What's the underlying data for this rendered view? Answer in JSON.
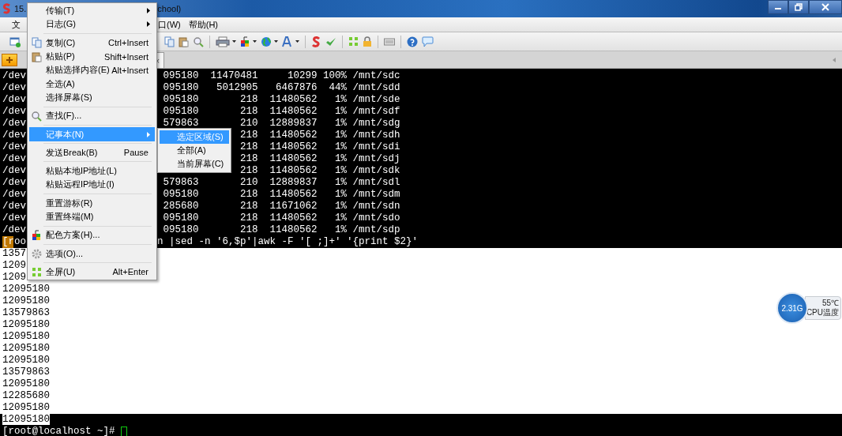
{
  "window": {
    "title_start": "15.",
    "title_end": "chool)"
  },
  "menubar": [
    "文",
    "口(W)",
    "帮助(H)"
  ],
  "tab": {
    "close": "×"
  },
  "context_menu": {
    "items": [
      {
        "kind": "item",
        "label": "传输(T)",
        "submenu": true,
        "selected": false
      },
      {
        "kind": "item",
        "label": "日志(G)",
        "submenu": true,
        "selected": false
      },
      {
        "kind": "separator"
      },
      {
        "kind": "item",
        "label": "复制(C)",
        "shortcut": "Ctrl+Insert",
        "submenu": false,
        "selected": false
      },
      {
        "kind": "item",
        "label": "粘贴(P)",
        "shortcut": "Shift+Insert",
        "submenu": false,
        "selected": false
      },
      {
        "kind": "item",
        "label": "粘贴选择内容(E)",
        "shortcut": "Alt+Insert",
        "submenu": false,
        "selected": false
      },
      {
        "kind": "item",
        "label": "全选(A)",
        "submenu": false,
        "selected": false
      },
      {
        "kind": "item",
        "label": "选择屏幕(S)",
        "submenu": false,
        "selected": false
      },
      {
        "kind": "separator"
      },
      {
        "kind": "item",
        "label": "查找(F)...",
        "submenu": false,
        "selected": false
      },
      {
        "kind": "separator"
      },
      {
        "kind": "item",
        "label": "记事本(N)",
        "submenu": true,
        "selected": true
      },
      {
        "kind": "separator"
      },
      {
        "kind": "item",
        "label": "发送Break(B)",
        "shortcut": "Pause",
        "submenu": false,
        "selected": false
      },
      {
        "kind": "separator"
      },
      {
        "kind": "item",
        "label": "粘贴本地IP地址(L)",
        "submenu": false,
        "selected": false
      },
      {
        "kind": "item",
        "label": "粘贴远程IP地址(I)",
        "submenu": false,
        "selected": false
      },
      {
        "kind": "separator"
      },
      {
        "kind": "item",
        "label": "重置游标(R)",
        "submenu": false,
        "selected": false
      },
      {
        "kind": "item",
        "label": "重置终端(M)",
        "submenu": false,
        "selected": false
      },
      {
        "kind": "separator"
      },
      {
        "kind": "item",
        "label": "配色方案(H)...",
        "submenu": false,
        "selected": false
      },
      {
        "kind": "separator"
      },
      {
        "kind": "item",
        "label": "选项(O)...",
        "submenu": false,
        "selected": false
      },
      {
        "kind": "separator"
      },
      {
        "kind": "item",
        "label": "全屏(U)",
        "shortcut": "Alt+Enter",
        "submenu": false,
        "selected": false
      }
    ]
  },
  "submenu": {
    "items": [
      {
        "label": "选定区域(S)",
        "selected": true
      },
      {
        "label": "全部(A)",
        "selected": false
      },
      {
        "label": "当前屏幕(C)",
        "selected": false
      }
    ]
  },
  "terminal": {
    "disk_rows": [
      {
        "left": "/dev",
        "right": "095180  11470481     10299 100% /mnt/sdc"
      },
      {
        "left": "/dev",
        "right": "095180   5012905   6467876  44% /mnt/sdd"
      },
      {
        "left": "/dev",
        "right": "095180       218  11480562   1% /mnt/sde"
      },
      {
        "left": "/dev",
        "right": "095180       218  11480562   1% /mnt/sdf"
      },
      {
        "left": "/dev",
        "right": "579863       210  12889837   1% /mnt/sdg"
      },
      {
        "left": "/dev",
        "right": "218  11480562   1% /mnt/sdh"
      },
      {
        "left": "/dev",
        "right": "218  11480562   1% /mnt/sdi"
      },
      {
        "left": "/dev",
        "right": "218  11480562   1% /mnt/sdj"
      },
      {
        "left": "/dev",
        "right": "218  11480562   1% /mnt/sdk"
      },
      {
        "left": "/dev",
        "right": "579863       210  12889837   1% /mnt/sdl"
      },
      {
        "left": "/dev",
        "right": "095180       218  11480562   1% /mnt/sdm"
      },
      {
        "left": "/dev",
        "right": "285680       218  11671062   1% /mnt/sdn"
      },
      {
        "left": "/dev",
        "right": "095180       218  11480562   1% /mnt/sdo"
      },
      {
        "left": "/dev",
        "right": "095180       218  11480562   1% /mnt/sdp"
      }
    ],
    "command": {
      "left": "[roo",
      "right": "n |sed -n '6,$p'|awk -F '[ ;]+' '{print $2}'"
    },
    "selection": {
      "selected": true,
      "lines": [
        "1357",
        "1209",
        "1209",
        "12095180",
        "12095180",
        "13579863",
        "12095180",
        "12095180",
        "12095180",
        "12095180",
        "13579863",
        "12095180",
        "12285680",
        "12095180",
        "12095180"
      ]
    },
    "prompt": "[root@localhost ~]# "
  },
  "cpu_widget": {
    "frequency": "2.31G",
    "temperature": "55℃",
    "label": "CPU温度"
  }
}
